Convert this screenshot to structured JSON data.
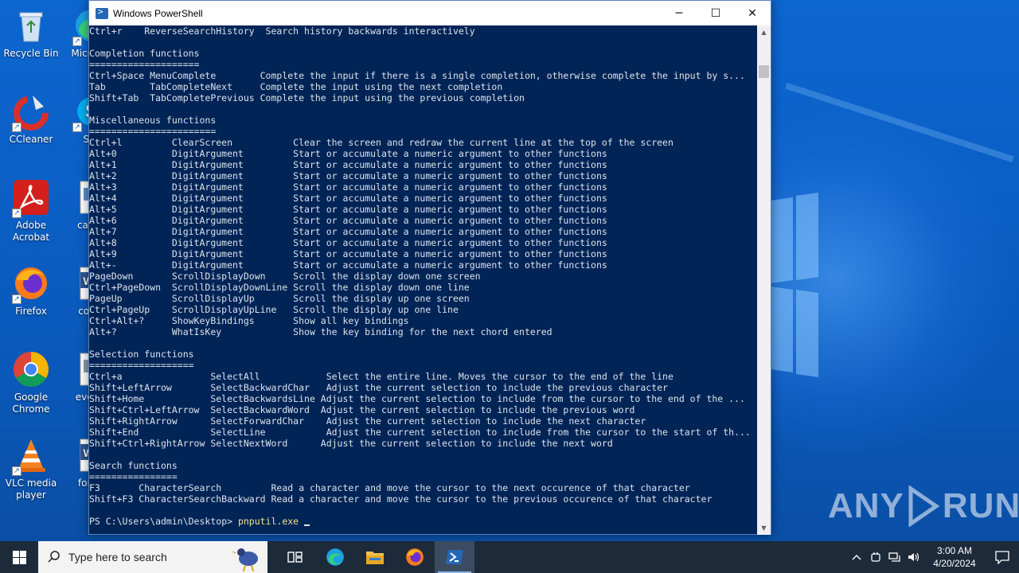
{
  "desktop": {
    "icons": [
      {
        "label": "Recycle Bin",
        "icon": "recycle-bin-icon"
      },
      {
        "label": "Micro Ed",
        "icon": "edge-icon"
      },
      {
        "label": "CCleaner",
        "icon": "ccleaner-icon"
      },
      {
        "label": "Sky",
        "icon": "skype-icon"
      },
      {
        "label": "Adobe Acrobat",
        "icon": "acrobat-icon"
      },
      {
        "label": "carsju",
        "icon": "image-file-icon"
      },
      {
        "label": "Firefox",
        "icon": "firefox-icon"
      },
      {
        "label": "conta",
        "icon": "word-doc-icon"
      },
      {
        "label": "Google Chrome",
        "icon": "chrome-icon"
      },
      {
        "label": "events",
        "icon": "image-file-icon"
      },
      {
        "label": "VLC media player",
        "icon": "vlc-icon"
      },
      {
        "label": "forms",
        "icon": "word-doc-icon"
      }
    ],
    "watermark": {
      "left": "ANY",
      "right": "RUN"
    }
  },
  "window": {
    "title": "Windows PowerShell",
    "controls": {
      "minimize": "─",
      "maximize": "☐",
      "close": "✕"
    },
    "console_lines": [
      "Ctrl+r    ReverseSearchHistory  Search history backwards interactively",
      "",
      "Completion functions",
      "====================",
      "Ctrl+Space MenuComplete        Complete the input if there is a single completion, otherwise complete the input by s...",
      "Tab        TabCompleteNext     Complete the input using the next completion",
      "Shift+Tab  TabCompletePrevious Complete the input using the previous completion",
      "",
      "Miscellaneous functions",
      "=======================",
      "Ctrl+l         ClearScreen           Clear the screen and redraw the current line at the top of the screen",
      "Alt+0          DigitArgument         Start or accumulate a numeric argument to other functions",
      "Alt+1          DigitArgument         Start or accumulate a numeric argument to other functions",
      "Alt+2          DigitArgument         Start or accumulate a numeric argument to other functions",
      "Alt+3          DigitArgument         Start or accumulate a numeric argument to other functions",
      "Alt+4          DigitArgument         Start or accumulate a numeric argument to other functions",
      "Alt+5          DigitArgument         Start or accumulate a numeric argument to other functions",
      "Alt+6          DigitArgument         Start or accumulate a numeric argument to other functions",
      "Alt+7          DigitArgument         Start or accumulate a numeric argument to other functions",
      "Alt+8          DigitArgument         Start or accumulate a numeric argument to other functions",
      "Alt+9          DigitArgument         Start or accumulate a numeric argument to other functions",
      "Alt+-          DigitArgument         Start or accumulate a numeric argument to other functions",
      "PageDown       ScrollDisplayDown     Scroll the display down one screen",
      "Ctrl+PageDown  ScrollDisplayDownLine Scroll the display down one line",
      "PageUp         ScrollDisplayUp       Scroll the display up one screen",
      "Ctrl+PageUp    ScrollDisplayUpLine   Scroll the display up one line",
      "Ctrl+Alt+?     ShowKeyBindings       Show all key bindings",
      "Alt+?          WhatIsKey             Show the key binding for the next chord entered",
      "",
      "Selection functions",
      "===================",
      "Ctrl+a                SelectAll            Select the entire line. Moves the cursor to the end of the line",
      "Shift+LeftArrow       SelectBackwardChar   Adjust the current selection to include the previous character",
      "Shift+Home            SelectBackwardsLine Adjust the current selection to include from the cursor to the end of the ...",
      "Shift+Ctrl+LeftArrow  SelectBackwardWord  Adjust the current selection to include the previous word",
      "Shift+RightArrow      SelectForwardChar    Adjust the current selection to include the next character",
      "Shift+End             SelectLine           Adjust the current selection to include from the cursor to the start of th...",
      "Shift+Ctrl+RightArrow SelectNextWord      Adjust the current selection to include the next word",
      "",
      "Search functions",
      "================",
      "F3       CharacterSearch         Read a character and move the cursor to the next occurence of that character",
      "Shift+F3 CharacterSearchBackward Read a character and move the cursor to the previous occurence of that character",
      ""
    ],
    "prompt": "PS C:\\Users\\admin\\Desktop> ",
    "command": "pnputil.exe"
  },
  "taskbar": {
    "search_placeholder": "Type here to search",
    "apps": [
      {
        "name": "task-view-icon",
        "active": false
      },
      {
        "name": "edge-icon",
        "active": false
      },
      {
        "name": "file-explorer-icon",
        "active": false
      },
      {
        "name": "firefox-icon",
        "active": false
      },
      {
        "name": "powershell-icon",
        "active": true
      }
    ],
    "time": "3:00 AM",
    "date": "4/20/2024"
  }
}
